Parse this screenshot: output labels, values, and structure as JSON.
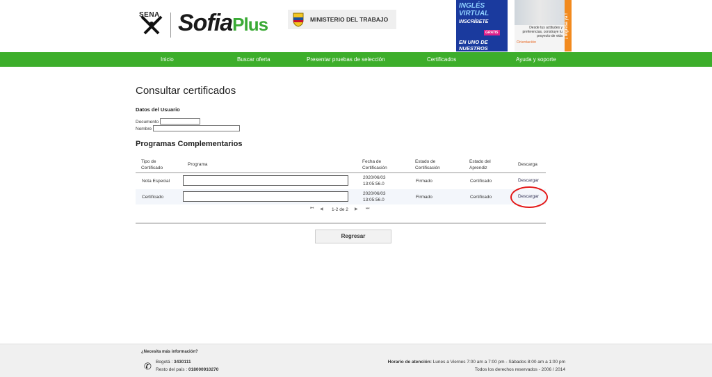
{
  "header": {
    "sena_label": "SENA",
    "sofia": "Sofia",
    "plus": "Plus",
    "ministerio": "MINISTERIO DEL TRABAJO",
    "banner_ingles": {
      "line1": "INGLÉS",
      "line2": "VIRTUAL",
      "line3": "INSCRÍBETE",
      "gratis": "GRATIS",
      "line4": "EN UNO DE NUESTROS CURSOS"
    },
    "banner_orient": {
      "text": "Desde tus actitudes y preferencias, construye tu proyecto de vida",
      "logo": "Orientación",
      "cta": "¡ Ingresa ya !"
    }
  },
  "nav": {
    "items": [
      {
        "label": "Inicio"
      },
      {
        "label": "Buscar oferta"
      },
      {
        "label": "Presentar pruebas de selección"
      },
      {
        "label": "Certificados"
      },
      {
        "label": "Ayuda y soporte"
      }
    ]
  },
  "page": {
    "title": "Consultar certificados",
    "datos_title": "Datos del Usuario",
    "documento_label": "Documento",
    "nombre_label": "Nombre",
    "documento_value": "",
    "nombre_value": "",
    "programas_title": "Programas Complementarios"
  },
  "table": {
    "headers": {
      "tipo": "Tipo de Certificado",
      "programa": "Programa",
      "fecha": "Fecha de Certificación",
      "estado_cert": "Estado de Certificación",
      "estado_apr": "Estado del Aprendiz",
      "descarga": "Descarga"
    },
    "rows": [
      {
        "tipo": "Nota Especial",
        "programa": "",
        "fecha1": "2020/06/03",
        "fecha2": "13:05:56.0",
        "estado_cert": "Firmado",
        "estado_apr": "Certificado",
        "descarga": "Descargar"
      },
      {
        "tipo": "Certificado",
        "programa": "",
        "fecha1": "2020/06/03",
        "fecha2": "13:05:56.0",
        "estado_cert": "Firmado",
        "estado_apr": "Certificado",
        "descarga": "Descargar"
      }
    ],
    "pager_text": "1-2 de 2"
  },
  "regresar_label": "Regresar",
  "footer": {
    "info": "¿Necesita más información?",
    "bogota_label": "Bogotá :",
    "bogota_value": "3430111",
    "resto_label": "Resto del país :",
    "resto_value": "018000910270",
    "horario_label": "Horario de atención:",
    "horario_value": "Lunes a Viernes 7:00 am a 7:00 pm - Sábados 8:00 am a 1:00 pm",
    "rights": "Todos los derechos reservados - 2006 / 2014"
  },
  "colors": {
    "nav_green": "#3dae2b",
    "highlight_red": "#e31919"
  }
}
